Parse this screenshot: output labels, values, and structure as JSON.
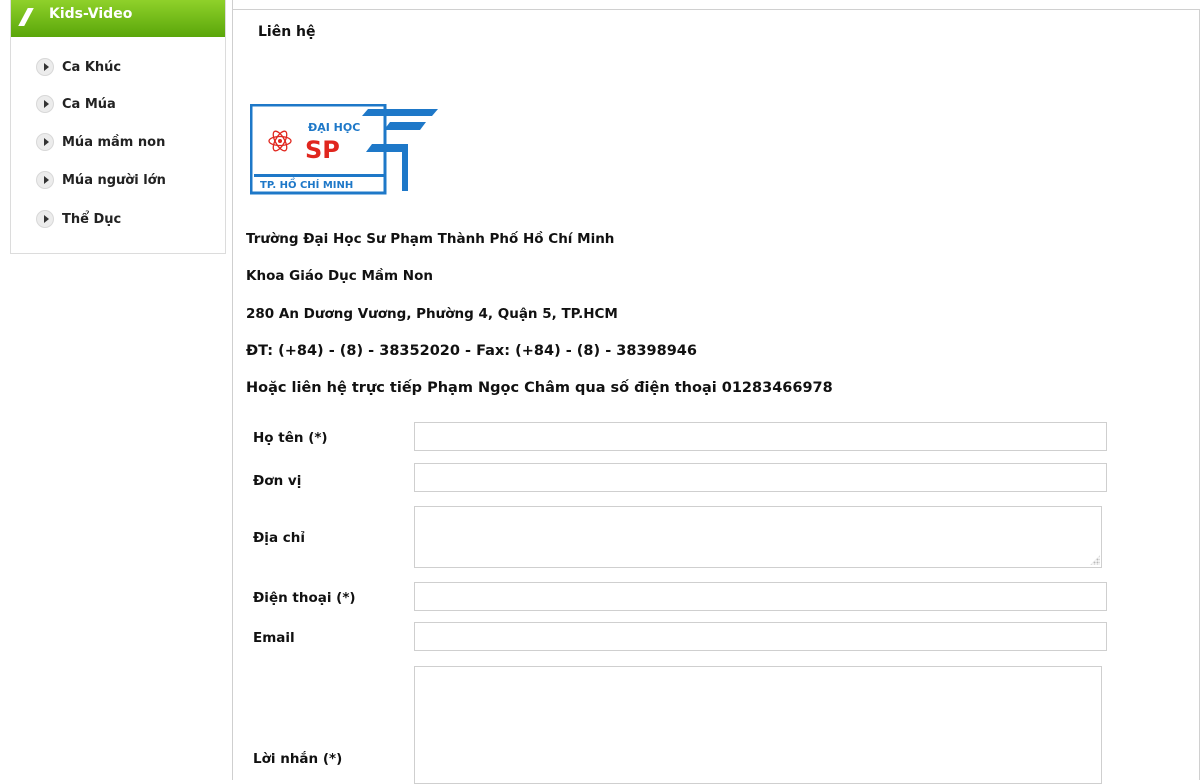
{
  "sidebar": {
    "title": "Kids-Video",
    "items": [
      {
        "label": "Ca Khúc"
      },
      {
        "label": "Ca Múa"
      },
      {
        "label": "Múa mầm non"
      },
      {
        "label": "Múa người lớn"
      },
      {
        "label": "Thể Dục"
      }
    ]
  },
  "page": {
    "title": "Liên hệ"
  },
  "logo": {
    "line1": "ĐẠI HỌC",
    "line2": "SP",
    "line3": "TP. HỒ CHÍ MINH"
  },
  "contact": {
    "university": "Trường Đại Học Sư Phạm Thành Phố Hồ Chí Minh",
    "faculty": "Khoa Giáo Dục Mầm Non",
    "address": "280 An Dương Vương, Phường 4, Quận 5, TP.HCM",
    "phone_fax": "ĐT: (+84) - (8) - 38352020  - Fax: (+84) - (8) - 38398946",
    "direct": "Hoặc liên hệ trực tiếp Phạm Ngọc Châm qua số điện thoại 01283466978"
  },
  "form": {
    "name_label": "Họ tên (*)",
    "unit_label": "Đơn vị",
    "address_label": "Địa chỉ",
    "phone_label": "Điện thoại (*)",
    "email_label": "Email",
    "message_label": "Lời nhắn (*)",
    "name_value": "",
    "unit_value": "",
    "address_value": "",
    "phone_value": "",
    "email_value": "",
    "message_value": ""
  },
  "colors": {
    "sidebar_header": "#6cbb14",
    "logo_blue": "#1e78c8",
    "logo_red": "#e0261e"
  }
}
